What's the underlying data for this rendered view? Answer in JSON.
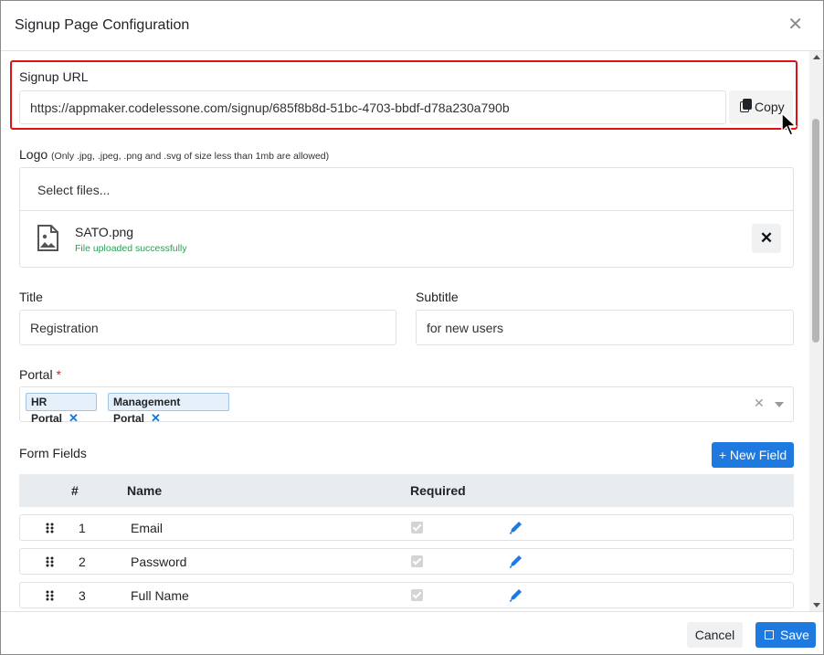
{
  "dialog": {
    "title": "Signup Page Configuration",
    "close_icon": "close-icon"
  },
  "signup_url": {
    "label": "Signup URL",
    "value": "https://appmaker.codelessone.com/signup/685f8b8d-51bc-4703-bbdf-d78a230a790b",
    "copy_label": "Copy",
    "highlight_color": "#e01111"
  },
  "logo": {
    "label": "Logo",
    "hint": "(Only .jpg, .jpeg, .png and .svg of size less than 1mb are allowed)",
    "select_label": "Select files...",
    "file_name": "SATO.png",
    "file_status": "File uploaded successfully",
    "remove_label": "✕"
  },
  "title_field": {
    "label": "Title",
    "value": "Registration"
  },
  "subtitle_field": {
    "label": "Subtitle",
    "value": "for new users"
  },
  "portal": {
    "label": "Portal",
    "required_mark": "*",
    "chips": [
      "HR Portal",
      "Management Portal"
    ],
    "chip_remove": "✕",
    "clear_label": "✕"
  },
  "form_fields": {
    "label": "Form Fields",
    "new_field_label": "+ New Field",
    "columns": [
      "#",
      "Name",
      "Required"
    ],
    "rows": [
      {
        "num": "1",
        "name": "Email",
        "required": true
      },
      {
        "num": "2",
        "name": "Password",
        "required": true
      },
      {
        "num": "3",
        "name": "Full Name",
        "required": true
      }
    ]
  },
  "footer": {
    "cancel_label": "Cancel",
    "save_label": "Save"
  },
  "colors": {
    "primary": "#1f7ae0",
    "success_text": "#2e9e56",
    "required": "#d9232d"
  }
}
